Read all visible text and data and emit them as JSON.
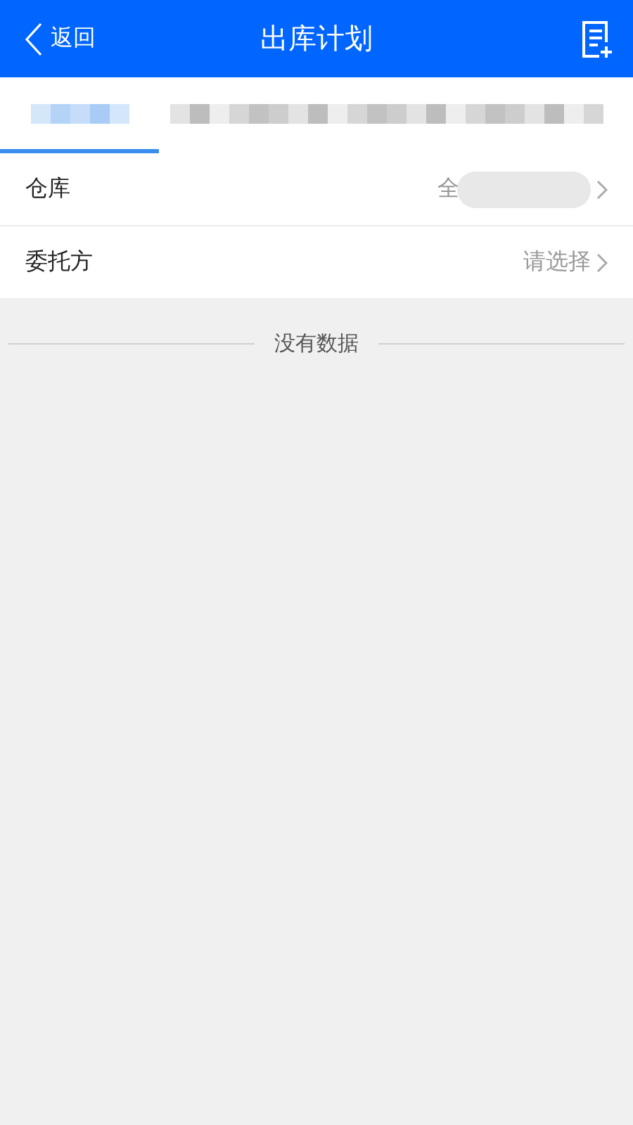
{
  "header": {
    "back": "返回",
    "title": "出库计划"
  },
  "tabs": [
    {
      "selected": true,
      "kind": "redacted"
    },
    {
      "selected": false,
      "kind": "redacted"
    }
  ],
  "fields": [
    {
      "label": "仓库",
      "value": "全",
      "redacted": true
    },
    {
      "label": "委托方",
      "value": "请选择",
      "redacted": false
    }
  ],
  "empty": "没有数据"
}
